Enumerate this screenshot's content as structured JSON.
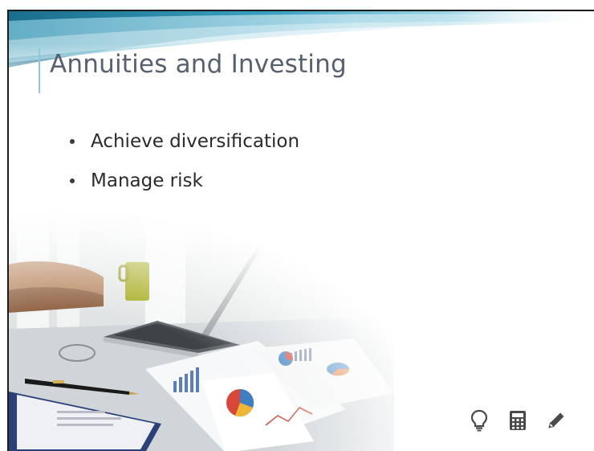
{
  "slide": {
    "title": "Annuities and Investing",
    "bullets": [
      "Achieve diversification",
      "Manage risk"
    ]
  },
  "toolbar": {
    "icons": [
      "lightbulb-icon",
      "calculator-icon",
      "pencil-icon"
    ]
  },
  "colors": {
    "title": "#56606e",
    "accent": "#8ec9d9",
    "banner": "#2b8fb0",
    "body_text": "#2b2b2b",
    "icon": "#4a4a4a"
  }
}
